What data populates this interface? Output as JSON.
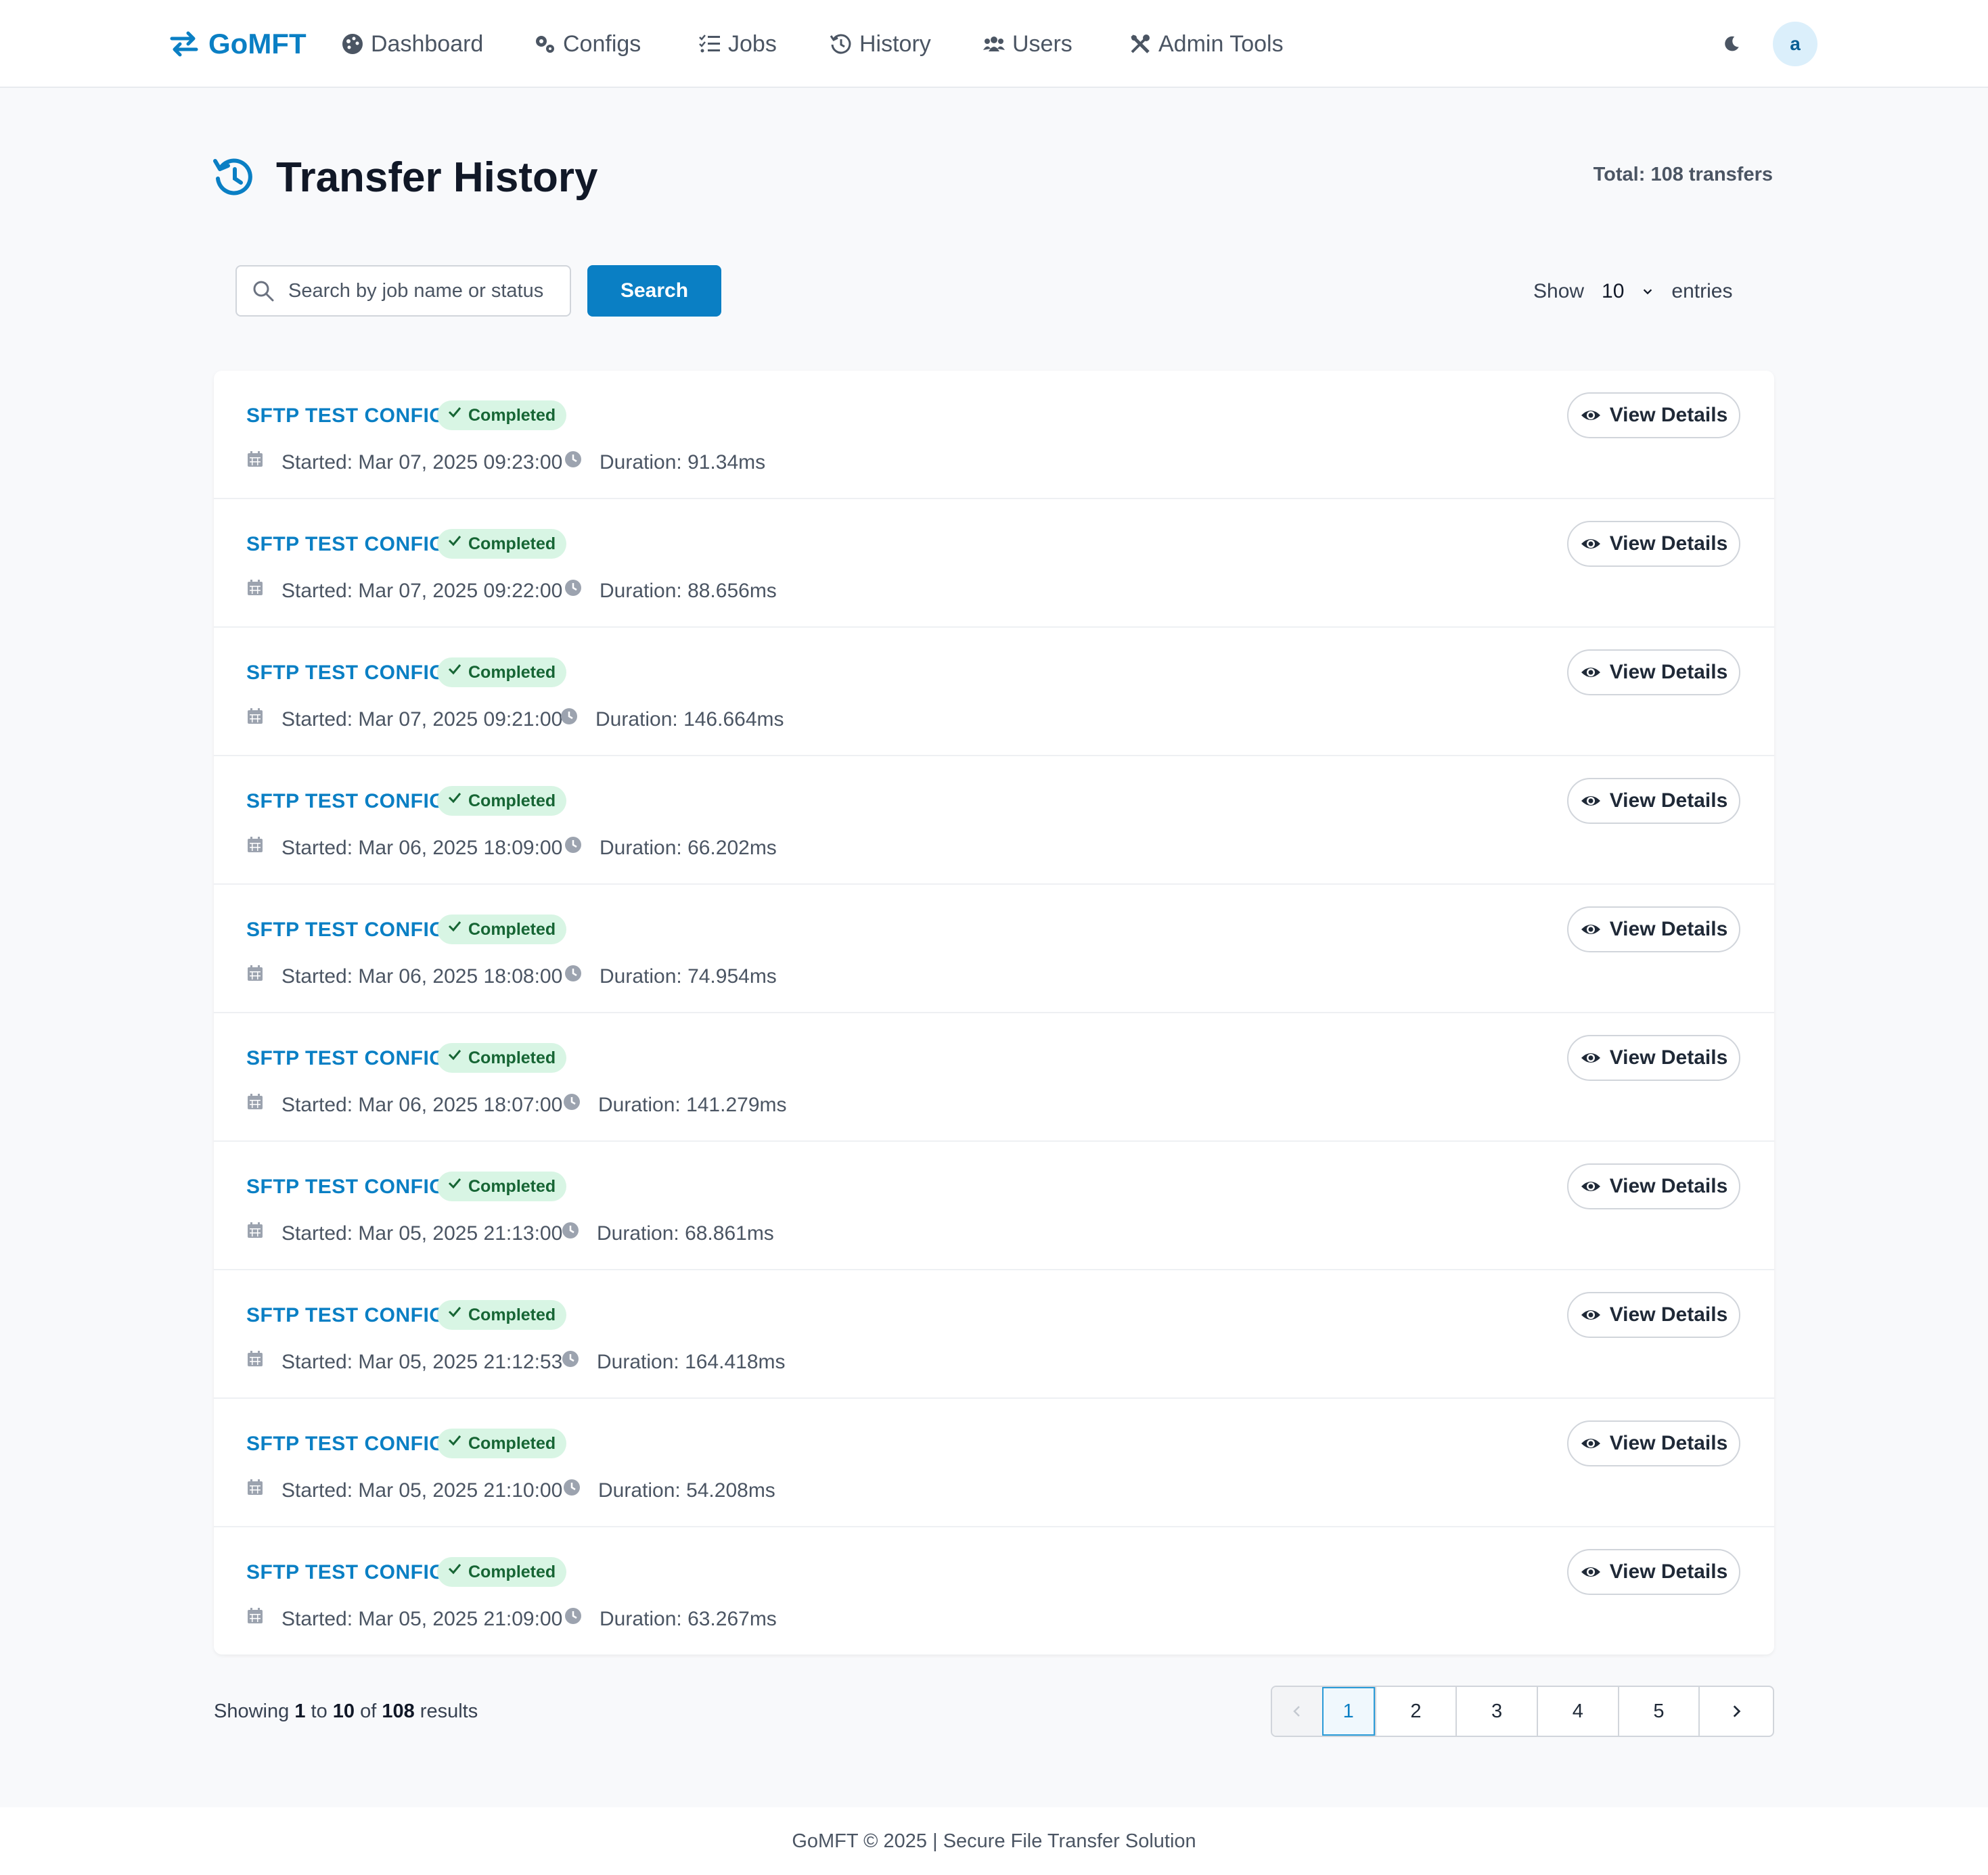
{
  "brand": {
    "name": "GoMFT",
    "color": "#0a7fc4",
    "icon": "arrows-exchange-icon"
  },
  "nav": [
    {
      "label": "Dashboard",
      "icon": "palette-icon"
    },
    {
      "label": "Configs",
      "icon": "gears-icon"
    },
    {
      "label": "Jobs",
      "icon": "list-check-icon"
    },
    {
      "label": "History",
      "icon": "history-icon"
    },
    {
      "label": "Users",
      "icon": "users-icon"
    },
    {
      "label": "Admin Tools",
      "icon": "tools-icon"
    }
  ],
  "user": {
    "avatar_letter": "a",
    "theme_icon": "moon-icon"
  },
  "page": {
    "title": "Transfer History",
    "title_icon": "history-icon",
    "total": "Total: 108 transfers"
  },
  "search": {
    "placeholder": "Search by job name or status",
    "value": "",
    "button_label": "Search"
  },
  "entries": {
    "show_label": "Show",
    "value": "10",
    "suffix": "entries"
  },
  "rows": [
    {
      "name": "SFTP TEST CONFIG",
      "status": "Completed",
      "started": "Started: Mar 07, 2025 09:23:00",
      "duration": "Duration: 91.34ms",
      "action": "View Details"
    },
    {
      "name": "SFTP TEST CONFIG",
      "status": "Completed",
      "started": "Started: Mar 07, 2025 09:22:00",
      "duration": "Duration: 88.656ms",
      "action": "View Details"
    },
    {
      "name": "SFTP TEST CONFIG",
      "status": "Completed",
      "started": "Started: Mar 07, 2025 09:21:00",
      "duration": "Duration: 146.664ms",
      "action": "View Details"
    },
    {
      "name": "SFTP TEST CONFIG",
      "status": "Completed",
      "started": "Started: Mar 06, 2025 18:09:00",
      "duration": "Duration: 66.202ms",
      "action": "View Details"
    },
    {
      "name": "SFTP TEST CONFIG",
      "status": "Completed",
      "started": "Started: Mar 06, 2025 18:08:00",
      "duration": "Duration: 74.954ms",
      "action": "View Details"
    },
    {
      "name": "SFTP TEST CONFIG",
      "status": "Completed",
      "started": "Started: Mar 06, 2025 18:07:00",
      "duration": "Duration: 141.279ms",
      "action": "View Details"
    },
    {
      "name": "SFTP TEST CONFIG",
      "status": "Completed",
      "started": "Started: Mar 05, 2025 21:13:00",
      "duration": "Duration: 68.861ms",
      "action": "View Details"
    },
    {
      "name": "SFTP TEST CONFIG",
      "status": "Completed",
      "started": "Started: Mar 05, 2025 21:12:53",
      "duration": "Duration: 164.418ms",
      "action": "View Details"
    },
    {
      "name": "SFTP TEST CONFIG",
      "status": "Completed",
      "started": "Started: Mar 05, 2025 21:10:00",
      "duration": "Duration: 54.208ms",
      "action": "View Details"
    },
    {
      "name": "SFTP TEST CONFIG",
      "status": "Completed",
      "started": "Started: Mar 05, 2025 21:09:00",
      "duration": "Duration: 63.267ms",
      "action": "View Details"
    }
  ],
  "summary": {
    "prefix": "Showing",
    "from": "1",
    "to_word": "to",
    "to": "10",
    "of_word": "of",
    "total": "108",
    "suffix": "results"
  },
  "pagination": {
    "pages": [
      "1",
      "2",
      "3",
      "4",
      "5"
    ],
    "active": "1"
  },
  "footer": {
    "text": "GoMFT © 2025 | Secure File Transfer Solution"
  },
  "colors": {
    "accent": "#0a7fc4",
    "success_bg": "#d8f5e4",
    "success_text": "#166534"
  }
}
